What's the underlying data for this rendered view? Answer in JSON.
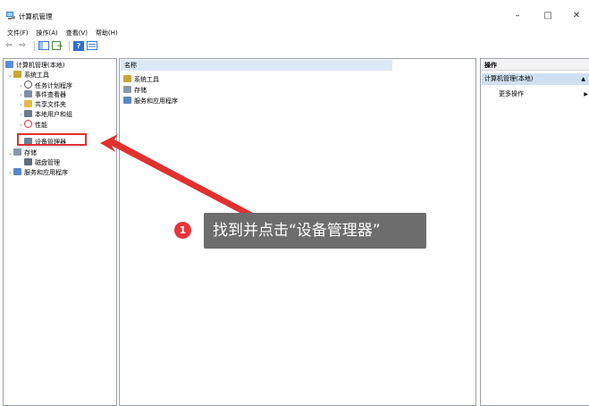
{
  "window": {
    "title": "计算机管理",
    "icon": "computer-management-icon",
    "controls": [
      "–",
      "□",
      "✕"
    ]
  },
  "menu": [
    "文件(F)",
    "操作(A)",
    "查看(V)",
    "帮助(H)"
  ],
  "toolbar": {
    "icons": [
      "back-arrow-icon",
      "forward-arrow-icon",
      "show-hide-tree-icon",
      "export-list-icon",
      "help-icon",
      "properties-icon"
    ],
    "back": "⇦",
    "forward": "⇨",
    "help": "?"
  },
  "tree": {
    "root": "计算机管理(本地)",
    "system_tools": "系统工具",
    "task_scheduler": "任务计划程序",
    "event_viewer": "事件查看器",
    "shared_folders": "共享文件夹",
    "local_users": "本地用户和组",
    "performance": "性能",
    "device_manager": "设备管理器",
    "storage": "存储",
    "disk_mgmt": "磁盘管理",
    "services_apps": "服务和应用程序",
    "expanded_glyph": "⌄",
    "collapsed_glyph": "›"
  },
  "list": {
    "column_name": "名称",
    "items": [
      "系统工具",
      "存储",
      "服务和应用程序"
    ]
  },
  "actions": {
    "header": "操作",
    "section": "计算机管理(本地)",
    "more": "更多操作",
    "section_arrow": "▲",
    "more_arrow": "▶"
  },
  "annotation": {
    "step": "1",
    "text": "找到并点击“设备管理器”",
    "color": "#e0312f"
  }
}
